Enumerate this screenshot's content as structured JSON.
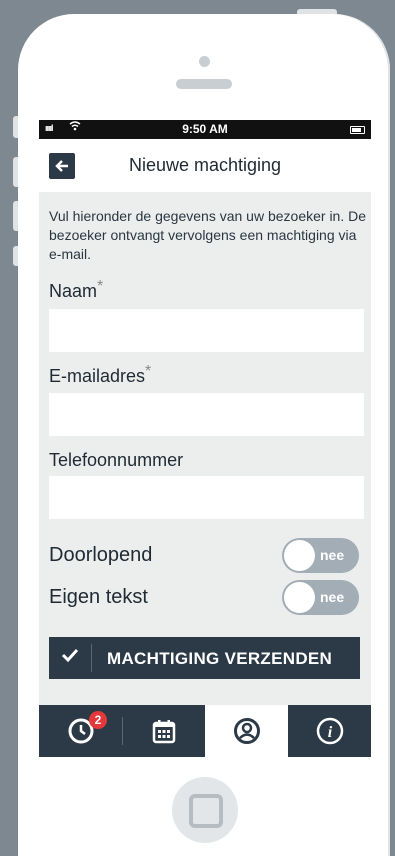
{
  "status_bar": {
    "signal": "ııııl",
    "time": "9:50 AM"
  },
  "header": {
    "title": "Nieuwe machtiging",
    "back_icon": "arrow-left-icon"
  },
  "intro_text": "Vul hieronder de gegevens van uw bezoeker in. De bezoeker ontvangt vervolgens een machtiging via e-mail.",
  "form": {
    "name": {
      "label": "Naam",
      "required_mark": "*",
      "value": ""
    },
    "email": {
      "label": "E-mailadres",
      "required_mark": "*",
      "value": ""
    },
    "phone": {
      "label": "Telefoonnummer",
      "value": ""
    }
  },
  "toggles": [
    {
      "label": "Doorlopend",
      "state_text": "nee"
    },
    {
      "label": "Eigen tekst",
      "state_text": "nee"
    }
  ],
  "submit": {
    "label": "MACHTIGING VERZENDEN",
    "icon": "check-icon"
  },
  "tabbar": {
    "tabs": [
      {
        "icon": "clock-icon",
        "badge": "2"
      },
      {
        "icon": "calendar-icon"
      },
      {
        "icon": "user-circle-icon",
        "active": true
      },
      {
        "icon": "info-icon"
      }
    ]
  },
  "colors": {
    "dark": "#2c3a47",
    "badge": "#e4393b",
    "background": "#7e8891",
    "screen": "#eceeee"
  }
}
